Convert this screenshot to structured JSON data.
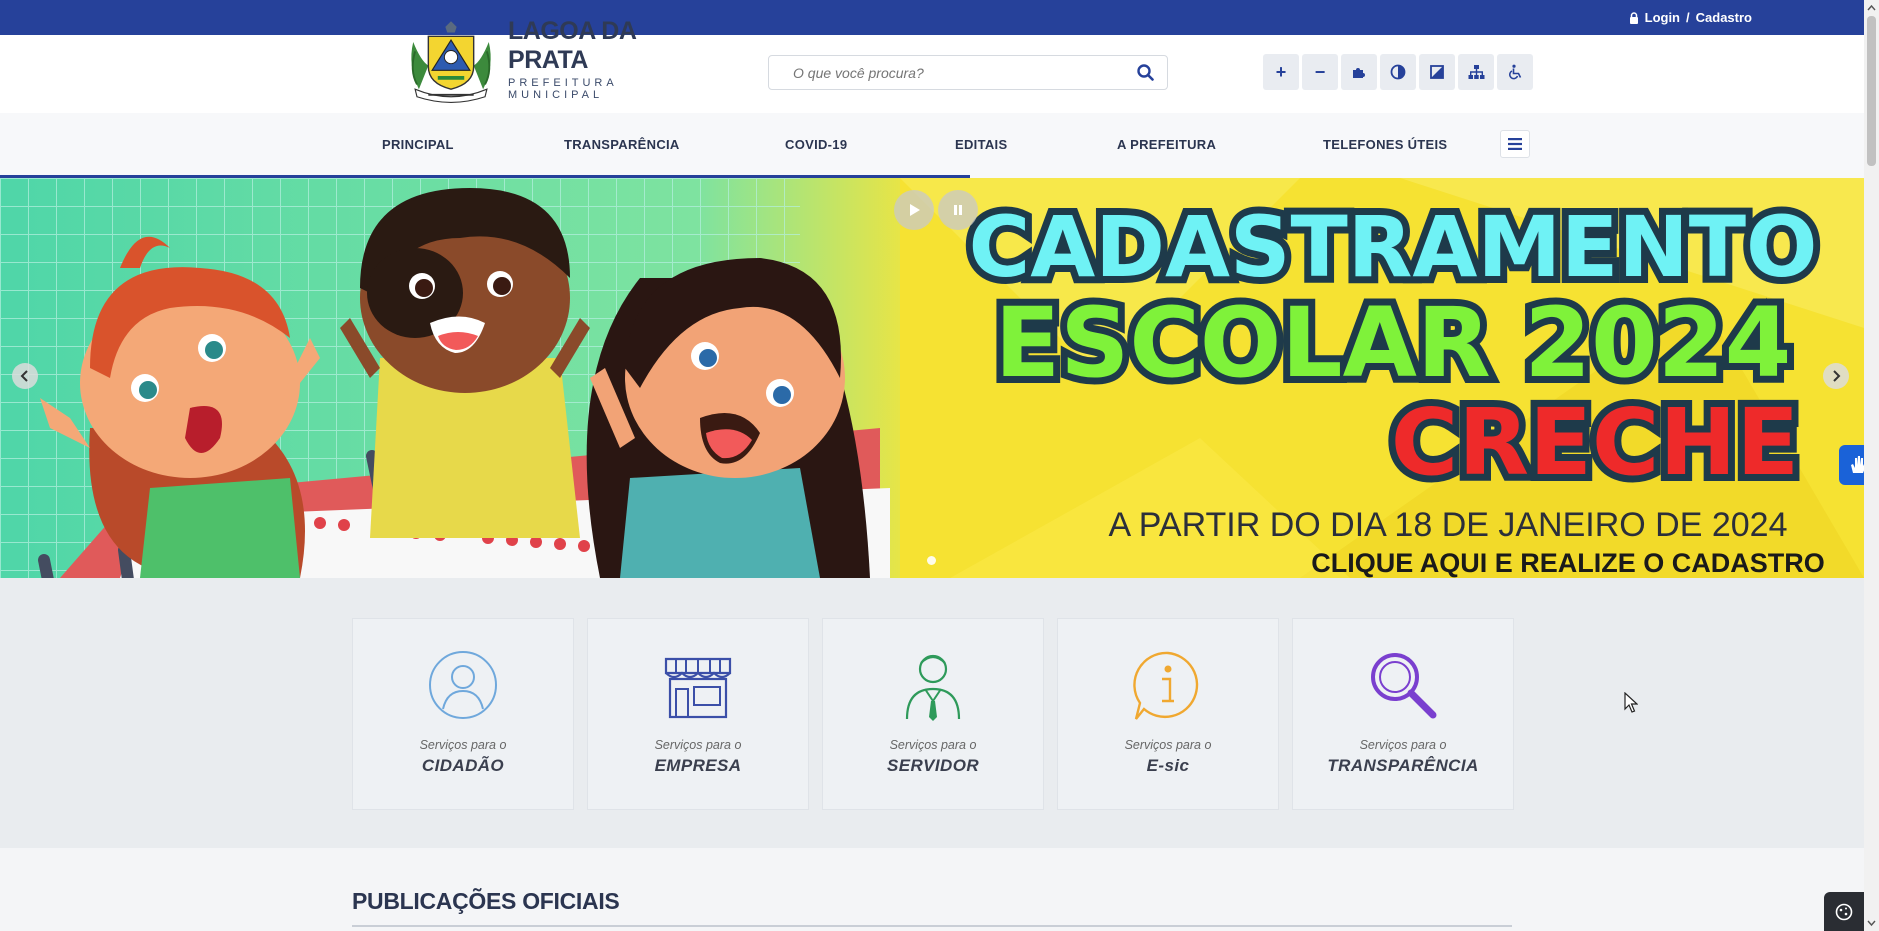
{
  "topbar": {
    "login": "Login",
    "separator": "/",
    "register": "Cadastro"
  },
  "header": {
    "brand_name": "LAGOA DA PRATA",
    "brand_sub": "PREFEITURA MUNICIPAL",
    "search_placeholder": "O que você procura?"
  },
  "accessibility": {
    "items": [
      {
        "label": "+",
        "icon": "font-increase-icon"
      },
      {
        "label": "−",
        "icon": "font-decrease-icon"
      },
      {
        "icon": "puzzle-icon"
      },
      {
        "icon": "contrast-icon"
      },
      {
        "icon": "high-contrast-icon"
      },
      {
        "icon": "sitemap-icon"
      },
      {
        "icon": "wheelchair-icon"
      }
    ]
  },
  "nav": {
    "items": [
      "PRINCIPAL",
      "TRANSPARÊNCIA",
      "COVID-19",
      "EDITAIS",
      "A PREFEITURA",
      "TELEFONES ÚTEIS"
    ]
  },
  "banner": {
    "line1": "CADASTRAMENTO",
    "line2": "ESCOLAR 2024",
    "line3": "CRECHE",
    "line4": "A PARTIR DO DIA 18 DE JANEIRO DE 2024",
    "line5": "CLIQUE AQUI E REALIZE O CADASTRO"
  },
  "services": {
    "prefix": "Serviços para o",
    "items": [
      {
        "label": "CIDADÃO",
        "icon": "user-icon",
        "color": "#6fa8dc"
      },
      {
        "label": "EMPRESA",
        "icon": "store-icon",
        "color": "#3b4fa8"
      },
      {
        "label": "SERVIDOR",
        "icon": "employee-icon",
        "color": "#2e9a5a"
      },
      {
        "label": "E-sic",
        "icon": "info-icon",
        "color": "#f0a830"
      },
      {
        "label": "TRANSPARÊNCIA",
        "icon": "magnifier-icon",
        "color": "#7a3fcf"
      }
    ]
  },
  "publications": {
    "title": "PUBLICAÇÕES OFICIAIS"
  }
}
